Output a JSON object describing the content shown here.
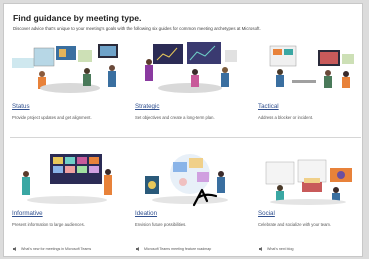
{
  "page": {
    "heading": "Find guidance by meeting type.",
    "subheading": "Discover advice that's unique to your meeting's goals with the following six guides for common meeting archetypes at Microsoft."
  },
  "cards": [
    {
      "title": "Status",
      "description": "Provide project updates and get alignment."
    },
    {
      "title": "Strategic",
      "description": "Set objectives and create a long-term plan."
    },
    {
      "title": "Tactical",
      "description": "Address a blocker or incident."
    },
    {
      "title": "Informative",
      "description": "Present information to large audiences."
    },
    {
      "title": "Ideation",
      "description": "Envision future possibilities."
    },
    {
      "title": "Social",
      "description": "Celebrate and socialize with your team."
    }
  ],
  "footer": {
    "links": [
      {
        "label": "What's new for meetings in Microsoft Teams"
      },
      {
        "label": "Microsoft Teams meeting feature roadmap"
      },
      {
        "label": "What's next blog"
      }
    ]
  },
  "colors": {
    "link": "#2f4f8f",
    "accent_teal": "#3aa7a3",
    "accent_purple": "#6b4fa0",
    "accent_orange": "#e8823a"
  }
}
